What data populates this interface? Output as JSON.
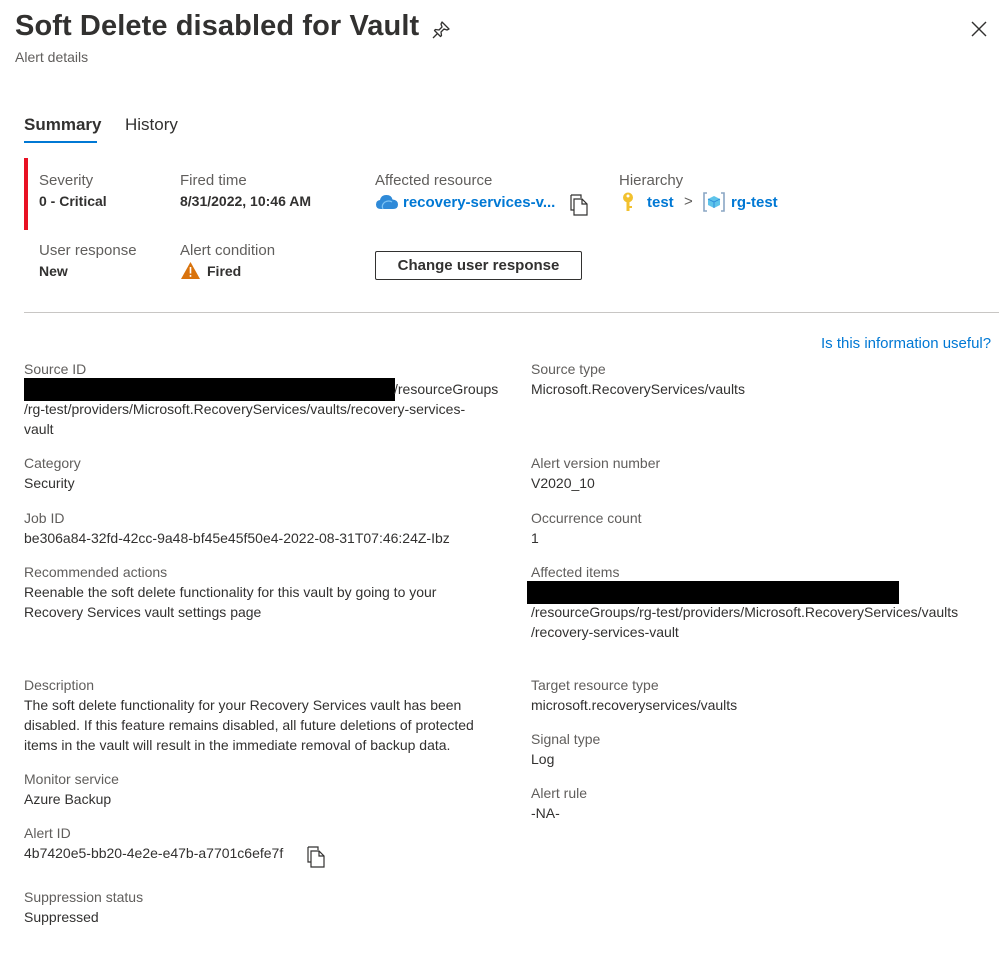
{
  "header": {
    "title": "Soft Delete disabled for Vault",
    "subtitle": "Alert details"
  },
  "tabs": [
    {
      "label": "Summary",
      "selected": true
    },
    {
      "label": "History",
      "selected": false
    }
  ],
  "summary": {
    "severity_label": "Severity",
    "severity_value": "0 - Critical",
    "fired_time_label": "Fired time",
    "fired_time_value": "8/31/2022, 10:46 AM",
    "affected_resource_label": "Affected resource",
    "affected_resource_value": "recovery-services-v...",
    "hierarchy_label": "Hierarchy",
    "hierarchy_items": [
      "test",
      "rg-test"
    ],
    "user_response_label": "User response",
    "user_response_value": "New",
    "alert_condition_label": "Alert condition",
    "alert_condition_value": "Fired",
    "change_button_label": "Change user response"
  },
  "useful_link": "Is this information useful?",
  "details_left": {
    "source_id_label": "Source ID",
    "source_id_line1": "/resourceGroups",
    "source_id_line2": "/rg-test/providers/Microsoft.RecoveryServices/vaults/recovery-services-",
    "source_id_line3": "vault",
    "category_label": "Category",
    "category_value": "Security",
    "job_id_label": "Job ID",
    "job_id_value": "be306a84-32fd-42cc-9a48-bf45e45f50e4-2022-08-31T07:46:24Z-Ibz",
    "recommended_label": "Recommended actions",
    "recommended_line1": "Reenable the soft delete functionality for this vault by going to your",
    "recommended_line2": "Recovery Services vault settings page",
    "description_label": "Description",
    "description_line1": "The soft delete functionality for your Recovery Services vault has been",
    "description_line2": "disabled. If this feature remains disabled, all future deletions of protected",
    "description_line3": "items in the vault will result in the immediate removal of backup data.",
    "monitor_label": "Monitor service",
    "monitor_value": "Azure Backup",
    "alert_id_label": "Alert ID",
    "alert_id_value": "4b7420e5-bb20-4e2e-e47b-a7701c6efe7f",
    "suppression_label": "Suppression status",
    "suppression_value": "Suppressed"
  },
  "details_right": {
    "source_type_label": "Source type",
    "source_type_value": "Microsoft.RecoveryServices/vaults",
    "alert_version_label": "Alert version number",
    "alert_version_value": "V2020_10",
    "occurrence_label": "Occurrence count",
    "occurrence_value": "1",
    "affected_items_label": "Affected items",
    "affected_items_line1": "/resourceGroups/rg-test/providers/Microsoft.RecoveryServices/vaults",
    "affected_items_line2": "/recovery-services-vault",
    "target_type_label": "Target resource type",
    "target_type_value": "microsoft.recoveryservices/vaults",
    "signal_type_label": "Signal type",
    "signal_type_value": "Log",
    "alert_rule_label": "Alert rule",
    "alert_rule_value": "-NA-"
  },
  "colors": {
    "accent": "#0078d4",
    "critical": "#e81123",
    "warning": "#d9730d"
  },
  "icons": [
    "pin-icon",
    "close-icon",
    "cloud-vault-icon",
    "copy-icon",
    "key-icon",
    "chevron-right-icon",
    "resource-group-icon",
    "warning-icon"
  ]
}
